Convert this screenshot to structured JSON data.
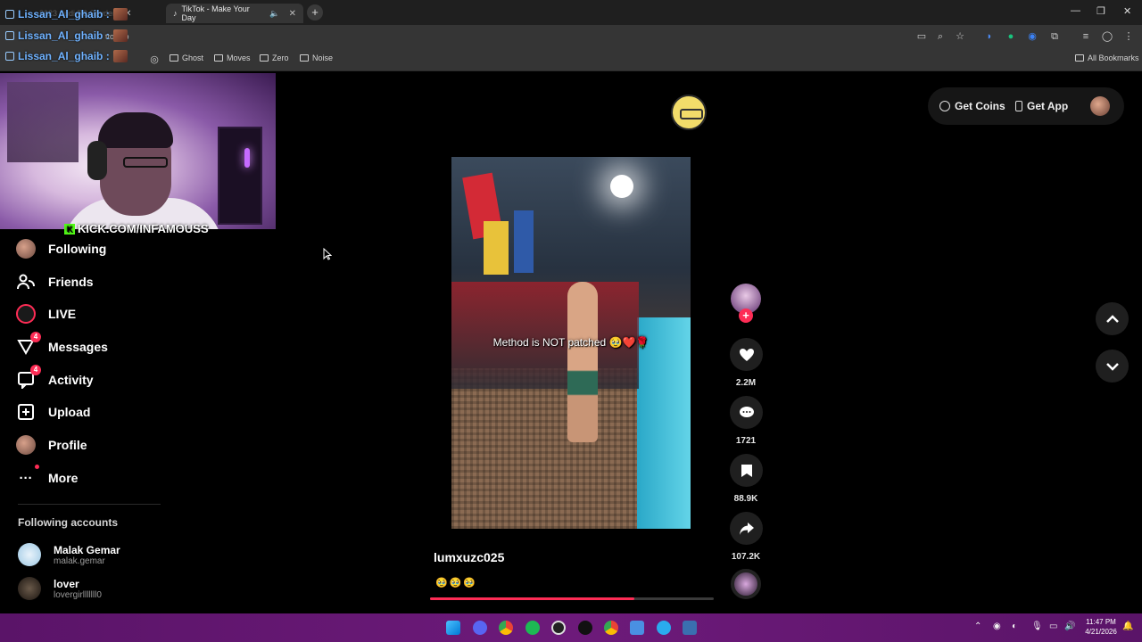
{
  "browser": {
    "tabs": [
      {
        "label": "2023 Audi R8 Spyder",
        "active": false
      },
      {
        "label": "TikTok - Make Your Day",
        "active": true
      }
    ],
    "address_fragment": "ttok.co",
    "window_controls": [
      "—",
      "❐",
      "✕"
    ],
    "bookmarks": [
      "Ghost",
      "Moves",
      "Zero",
      "Noise"
    ],
    "all_bookmarks_label": "All Bookmarks"
  },
  "chat": {
    "lines": [
      {
        "user": "Lissan_Al_ghaib :"
      },
      {
        "user": "Lissan_Al_ghaib :"
      },
      {
        "user": "Lissan_Al_ghaib :"
      }
    ]
  },
  "stream": {
    "overlay_text": "KICK.COM/INFAMOUSS",
    "brand_color": "#53fc18"
  },
  "sidebar": {
    "items": [
      {
        "label": "Following",
        "icon": "avatar-icon"
      },
      {
        "label": "Friends",
        "icon": "friends-icon"
      },
      {
        "label": "LIVE",
        "icon": "live-icon"
      },
      {
        "label": "Messages",
        "icon": "messages-icon",
        "badge": "4"
      },
      {
        "label": "Activity",
        "icon": "activity-icon",
        "badge": "4"
      },
      {
        "label": "Upload",
        "icon": "upload-icon"
      },
      {
        "label": "Profile",
        "icon": "profile-avatar-icon"
      },
      {
        "label": "More",
        "icon": "more-icon"
      }
    ],
    "following_title": "Following accounts",
    "accounts": [
      {
        "name": "Malak Gemar",
        "handle": "malak.gemar"
      },
      {
        "name": "lover",
        "handle": "lovergirlllllll0"
      }
    ]
  },
  "top": {
    "get_coins": "Get Coins",
    "get_app": "Get App"
  },
  "video": {
    "caption": "Method is NOT patched 🥹❤️🌹",
    "username": "lumxuzc025",
    "description": "🥹🥹🥹",
    "progress": 0.72
  },
  "actions": {
    "likes": "2.2M",
    "comments": "1721",
    "saves": "88.9K",
    "shares": "107.2K"
  },
  "taskbar": {
    "time": "11:47 PM",
    "date": "4/21/2026"
  },
  "colors": {
    "accent": "#fe2c55",
    "chat_name": "#6fb2ff",
    "taskbar": "#5a1468"
  }
}
